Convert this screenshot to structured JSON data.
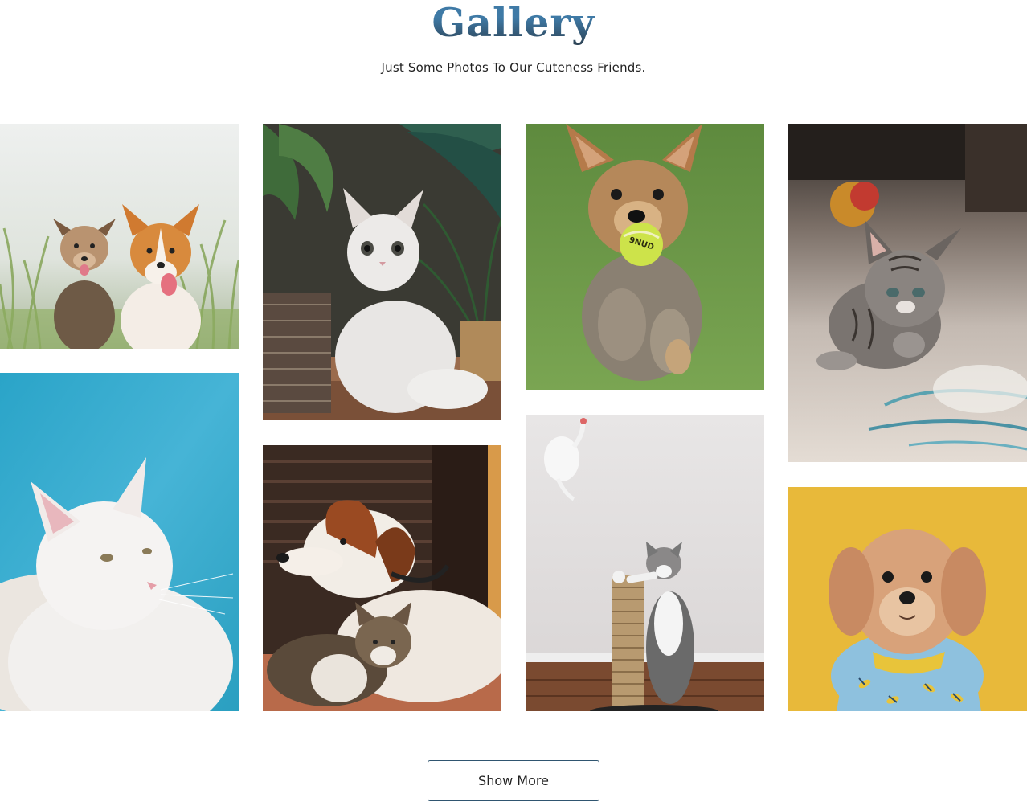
{
  "gallery": {
    "title": "Gallery",
    "subtitle": "Just Some Photos To Our Cuteness Friends.",
    "photos": [
      {
        "id": "p1",
        "subject": "two dogs in grass field"
      },
      {
        "id": "p2",
        "subject": "white cat on blue background"
      },
      {
        "id": "p3",
        "subject": "white fluffy cat with plants"
      },
      {
        "id": "p4",
        "subject": "dog and cat resting together"
      },
      {
        "id": "p5",
        "subject": "yorkie running with tennis ball"
      },
      {
        "id": "p6",
        "subject": "kitten on scratching post"
      },
      {
        "id": "p7",
        "subject": "tabby kitten on rug"
      },
      {
        "id": "p8",
        "subject": "small dog on yellow background"
      }
    ],
    "show_more_label": "Show More"
  },
  "colors": {
    "title_top": "#3f7aa6",
    "title_bottom": "#2c3f4f",
    "button_border": "#2f5570",
    "text": "#222222"
  }
}
